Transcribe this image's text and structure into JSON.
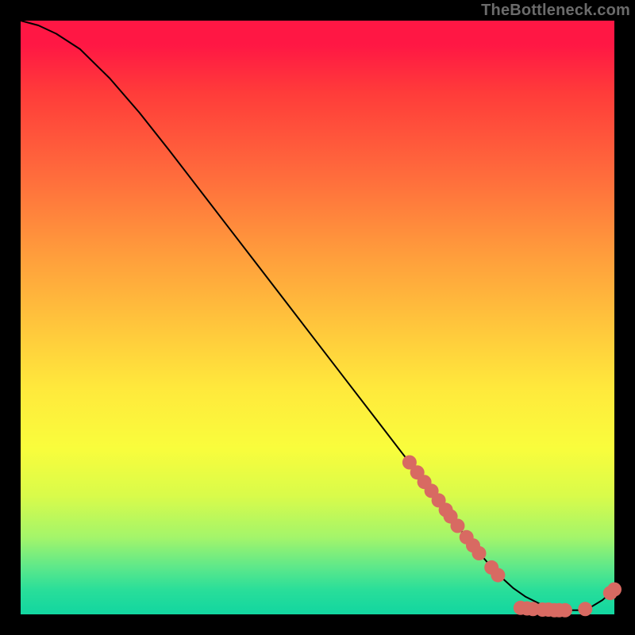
{
  "watermark": "TheBottleneck.com",
  "chart_data": {
    "type": "line",
    "title": "",
    "xlabel": "",
    "ylabel": "",
    "xlim": [
      0,
      100
    ],
    "ylim": [
      0,
      100
    ],
    "grid": false,
    "legend": false,
    "series": [
      {
        "name": "curve",
        "x": [
          0,
          3,
          6,
          10,
          15,
          20,
          25,
          30,
          35,
          40,
          45,
          50,
          55,
          60,
          65,
          70,
          73,
          76,
          79,
          81,
          83,
          85,
          88,
          90,
          92,
          94,
          96,
          98,
          100
        ],
        "y": [
          100,
          99.2,
          97.8,
          95.2,
          90.3,
          84.5,
          78.2,
          71.7,
          65.2,
          58.7,
          52.2,
          45.7,
          39.2,
          32.7,
          26.2,
          19.7,
          15.6,
          11.8,
          8.3,
          6.2,
          4.4,
          3.0,
          1.5,
          0.9,
          0.7,
          0.7,
          1.2,
          2.4,
          4.2
        ]
      }
    ],
    "markers": {
      "name": "dots",
      "color": "#d86a62",
      "radius": 9,
      "points": [
        {
          "x": 65.5,
          "y": 25.6
        },
        {
          "x": 66.8,
          "y": 23.9
        },
        {
          "x": 68.0,
          "y": 22.3
        },
        {
          "x": 69.2,
          "y": 20.8
        },
        {
          "x": 70.4,
          "y": 19.2
        },
        {
          "x": 71.6,
          "y": 17.6
        },
        {
          "x": 72.4,
          "y": 16.5
        },
        {
          "x": 73.6,
          "y": 14.9
        },
        {
          "x": 75.1,
          "y": 13.0
        },
        {
          "x": 76.2,
          "y": 11.6
        },
        {
          "x": 77.2,
          "y": 10.3
        },
        {
          "x": 79.3,
          "y": 7.9
        },
        {
          "x": 80.4,
          "y": 6.6
        },
        {
          "x": 84.2,
          "y": 1.1
        },
        {
          "x": 85.3,
          "y": 1.0
        },
        {
          "x": 86.3,
          "y": 0.9
        },
        {
          "x": 87.9,
          "y": 0.8
        },
        {
          "x": 88.9,
          "y": 0.8
        },
        {
          "x": 89.9,
          "y": 0.7
        },
        {
          "x": 90.7,
          "y": 0.7
        },
        {
          "x": 91.7,
          "y": 0.7
        },
        {
          "x": 95.1,
          "y": 0.9
        },
        {
          "x": 99.3,
          "y": 3.6
        },
        {
          "x": 100.0,
          "y": 4.2
        }
      ]
    }
  }
}
